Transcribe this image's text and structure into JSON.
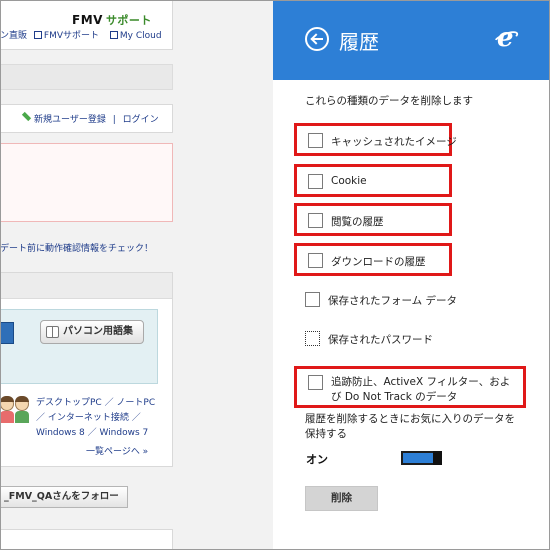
{
  "webpage": {
    "brand": {
      "name": "FMV",
      "sub": "サポート"
    },
    "top_links": [
      "ン直販",
      "FMVサポート",
      "My Cloud"
    ],
    "user_links": {
      "register": "新規ユーザー登録",
      "separator": "|",
      "login": "ログイン"
    },
    "notice": "デート前に動作確認情報をチェック！",
    "dictionary_button": "パソコン用語集",
    "categories": [
      "デスクトップPC ／ ノートPC",
      "／ インターネット接続 ／",
      "Windows 8 ／ Windows 7"
    ],
    "more_link": "一覧ページへ »",
    "follow_button": "_FMV_QAさんをフォロー"
  },
  "pane": {
    "title": "履歴",
    "intro": "これらの種類のデータを削除します",
    "options": [
      {
        "label": "キャッシュされたイメージ",
        "highlighted": true
      },
      {
        "label": "Cookie",
        "highlighted": true
      },
      {
        "label": "閲覧の履歴",
        "highlighted": true
      },
      {
        "label": "ダウンロードの履歴",
        "highlighted": true
      },
      {
        "label": "保存されたフォーム データ",
        "highlighted": false
      },
      {
        "label": "保存されたパスワード",
        "highlighted": false
      },
      {
        "label_line1": "追跡防止、ActiveX フィルター、およ",
        "label_line2": "び Do Not Track のデータ",
        "highlighted": true
      }
    ],
    "favorites_note": "履歴を削除するときにお気に入りのデータを保持する",
    "toggle_label": "オン",
    "toggle_on": true,
    "delete_button": "削除",
    "accent_color": "#2d7fd6",
    "highlight_color": "#e01818"
  }
}
